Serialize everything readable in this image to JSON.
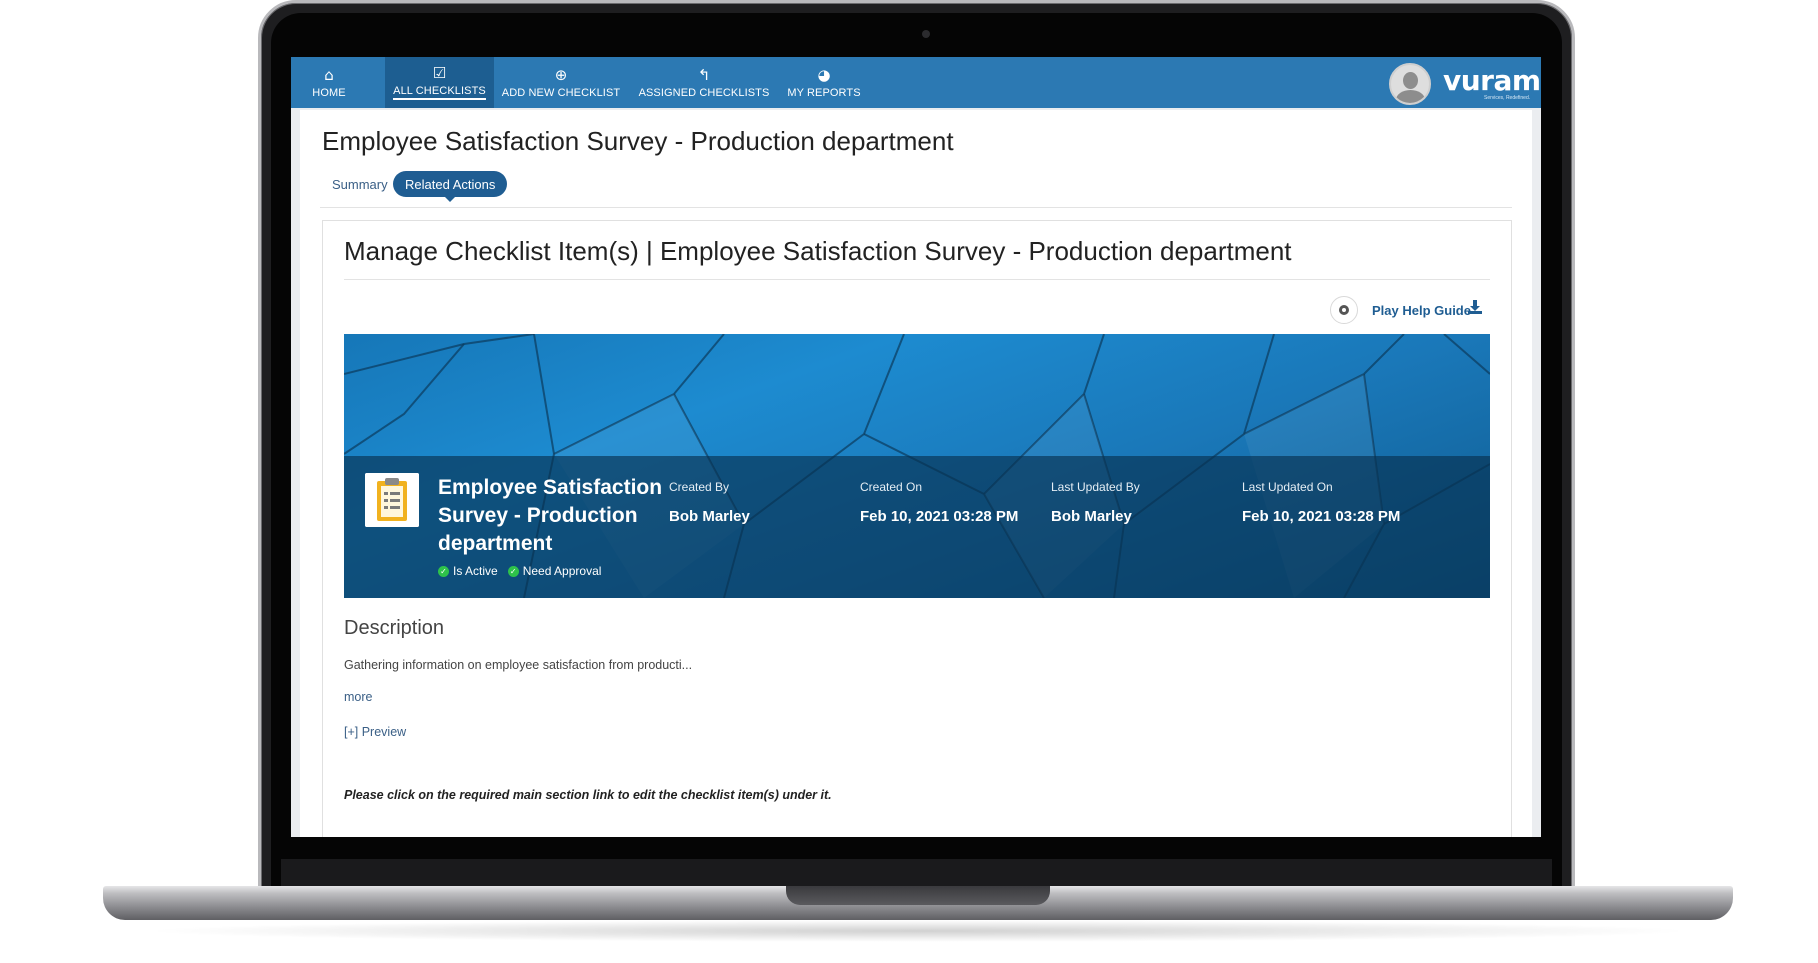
{
  "nav": {
    "items": [
      {
        "label": "HOME",
        "icon": "home-icon",
        "glyph": "⌂",
        "active": false
      },
      {
        "label": "ALL CHECKLISTS",
        "icon": "checkbox-icon",
        "glyph": "☑",
        "active": true
      },
      {
        "label": "ADD NEW CHECKLIST",
        "icon": "plus-circle-icon",
        "glyph": "⊕",
        "active": false
      },
      {
        "label": "ASSIGNED CHECKLISTS",
        "icon": "reply-icon",
        "glyph": "↰",
        "active": false
      },
      {
        "label": "MY REPORTS",
        "icon": "pie-chart-icon",
        "glyph": "◕",
        "active": false
      }
    ],
    "brand": "vuram",
    "brand_tagline": "Services, Redefined."
  },
  "page": {
    "title": "Employee Satisfaction Survey - Production department",
    "tabs": {
      "summary": "Summary",
      "related": "Related Actions"
    }
  },
  "panel": {
    "title": "Manage Checklist Item(s) | Employee Satisfaction Survey - Production department",
    "help_guide": "Play Help Guide"
  },
  "banner": {
    "name": "Employee Satisfaction Survey - Production department",
    "flags": {
      "active": "Is Active",
      "approval": "Need Approval"
    },
    "meta": {
      "created_by_label": "Created By",
      "created_by": "Bob Marley",
      "created_on_label": "Created On",
      "created_on": "Feb 10, 2021 03:28 PM",
      "updated_by_label": "Last Updated By",
      "updated_by": "Bob Marley",
      "updated_on_label": "Last Updated On",
      "updated_on": "Feb 10, 2021 03:28 PM"
    }
  },
  "description": {
    "title": "Description",
    "text": "Gathering information on employee satisfaction from producti...",
    "more": "more",
    "preview": "[+] Preview"
  },
  "instruction": "Please click on the required main section link to edit the checklist item(s) under it.",
  "colors": {
    "navbar": "#2c79b3",
    "nav_active": "#1d5e91",
    "accent": "#1f5d92",
    "check": "#2ec24a"
  }
}
